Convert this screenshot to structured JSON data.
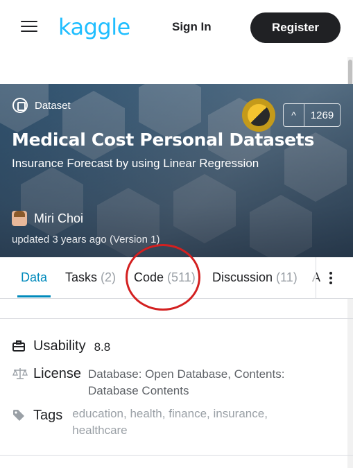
{
  "header": {
    "logo_text": "kaggle",
    "sign_in_label": "Sign In",
    "register_label": "Register"
  },
  "hero": {
    "type_label": "Dataset",
    "title": "Medical Cost Personal Datasets",
    "subtitle": "Insurance Forecast by using Linear Regression",
    "upvote_count": "1269",
    "author_name": "Miri Choi",
    "updated_text": "updated 3 years ago (Version 1)"
  },
  "tabs": [
    {
      "label": "Data",
      "count": ""
    },
    {
      "label": "Tasks",
      "count": "(2)"
    },
    {
      "label": "Code",
      "count": "(511)"
    },
    {
      "label": "Discussion",
      "count": "(11)"
    },
    {
      "label": "A",
      "count": ""
    }
  ],
  "meta": {
    "usability_label": "Usability",
    "usability_value": "8.8",
    "license_label": "License",
    "license_value": "Database: Open Database, Contents: Database Contents",
    "tags_label": "Tags",
    "tags": [
      "education",
      "health",
      "finance",
      "insurance",
      "healthcare"
    ]
  },
  "colors": {
    "kaggle_blue": "#20beff",
    "tab_active": "#008abc",
    "annotation_red": "#d32020"
  }
}
